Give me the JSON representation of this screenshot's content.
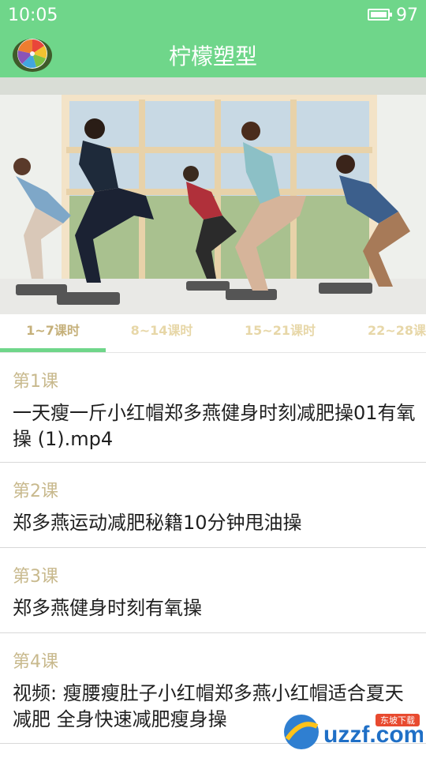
{
  "status_bar": {
    "time": "10:05",
    "battery_level": "97"
  },
  "app_bar": {
    "title": "柠檬塑型"
  },
  "tabs": [
    {
      "label": "1~7课时",
      "active": true
    },
    {
      "label": "8~14课时",
      "active": false
    },
    {
      "label": "15~21课时",
      "active": false
    },
    {
      "label": "22~28课时",
      "active": false
    }
  ],
  "lessons": [
    {
      "number": "第1课",
      "title": "一天瘦一斤小红帽郑多燕健身时刻减肥操01有氧操 (1).mp4"
    },
    {
      "number": "第2课",
      "title": "郑多燕运动减肥秘籍10分钟甩油操"
    },
    {
      "number": "第3课",
      "title": "郑多燕健身时刻有氧操"
    },
    {
      "number": "第4课",
      "title": "视频: 瘦腰瘦肚子小红帽郑多燕小红帽适合夏天减肥 全身快速减肥瘦身操"
    }
  ],
  "watermark": {
    "text": "uzzf.com",
    "badge": "东坡下载"
  },
  "colors": {
    "accent": "#6fd68a",
    "lesson_number": "#c8b98d",
    "tab_inactive": "#e7d7a8"
  }
}
